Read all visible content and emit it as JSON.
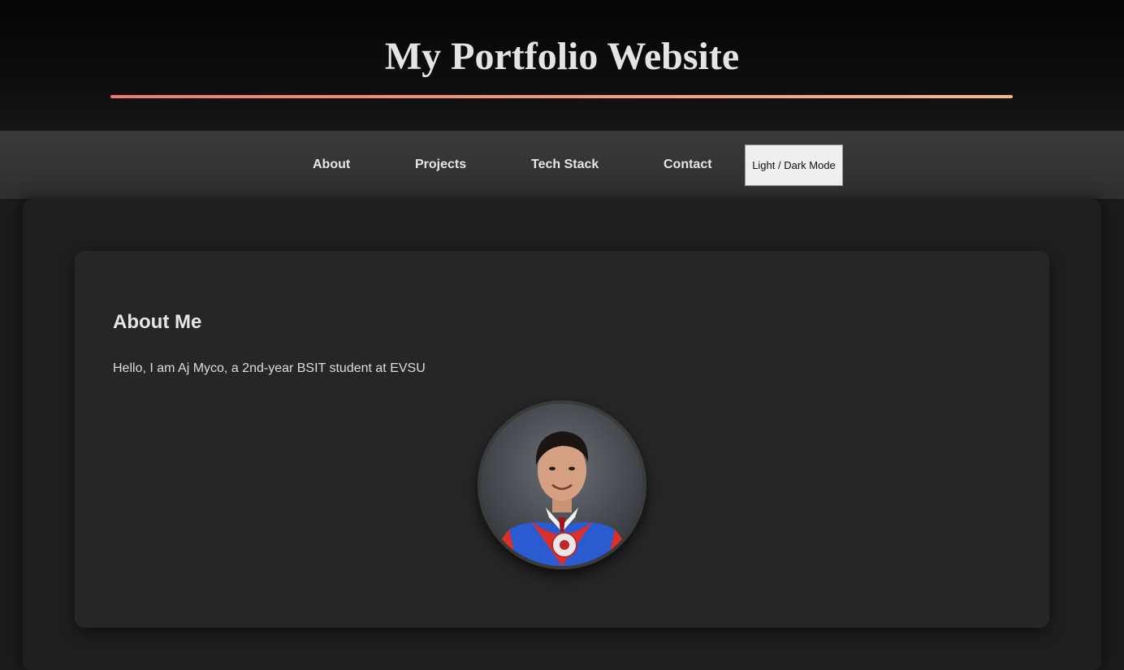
{
  "header": {
    "title": "My Portfolio Website"
  },
  "nav": {
    "items": [
      {
        "label": "About"
      },
      {
        "label": "Projects"
      },
      {
        "label": "Tech Stack"
      },
      {
        "label": "Contact"
      }
    ],
    "mode_toggle_label": "Light / Dark Mode"
  },
  "about": {
    "heading": "About Me",
    "text": "Hello, I am Aj Myco, a 2nd-year BSIT student at EVSU",
    "avatar_icon": "profile-photo"
  },
  "colors": {
    "accent_start": "#f07a6a",
    "accent_end": "#f6b887",
    "background": "#1b1b1b",
    "card": "#262626"
  }
}
